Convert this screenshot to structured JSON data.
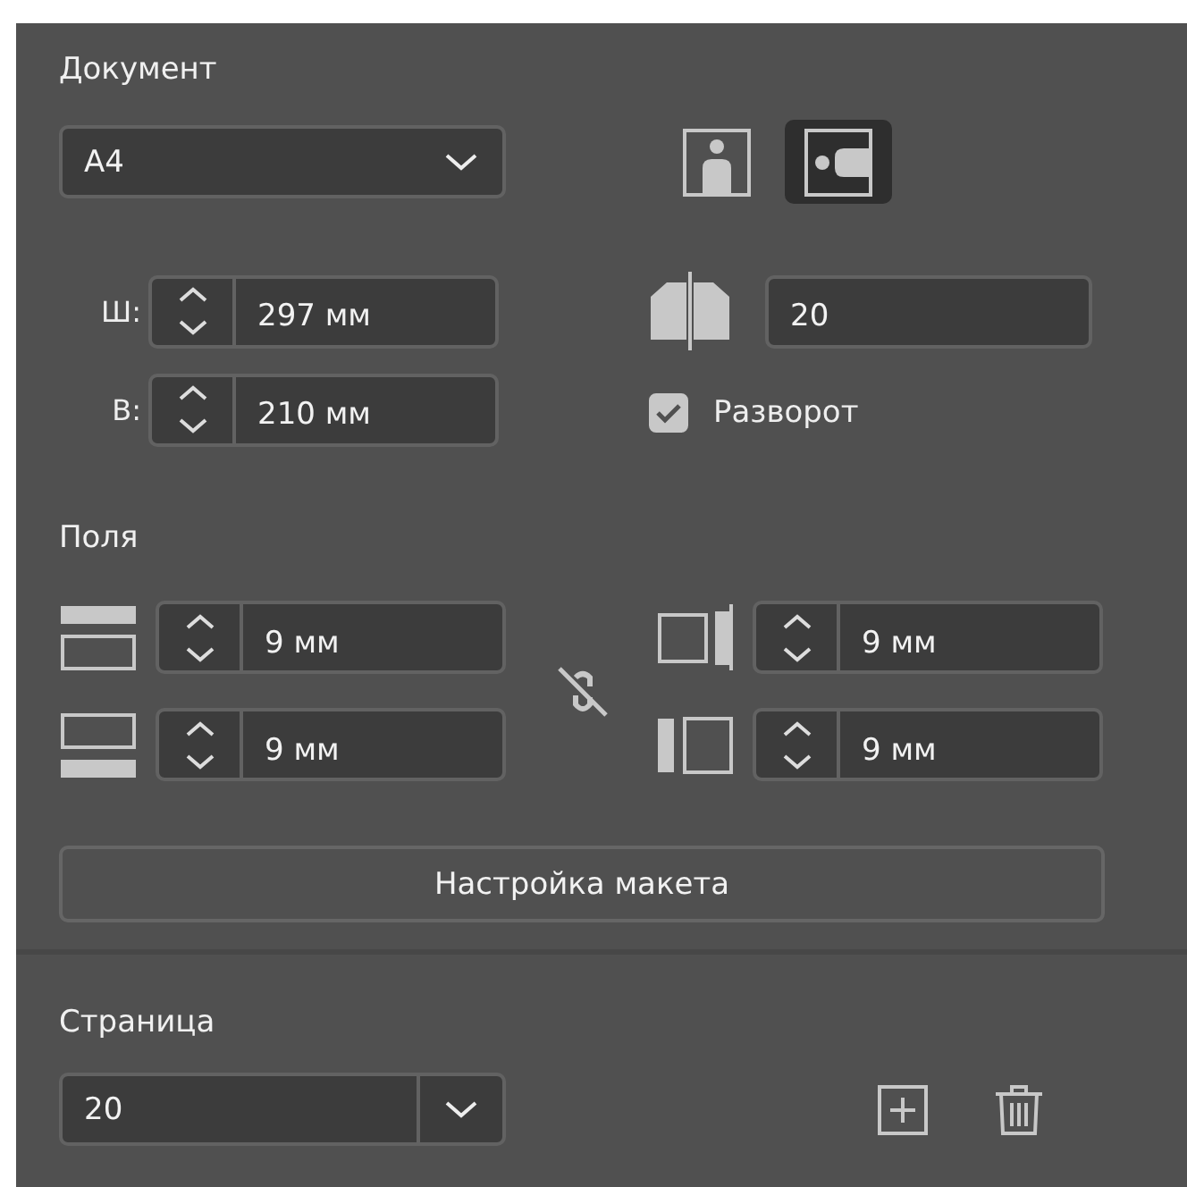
{
  "document": {
    "title": "Документ",
    "size": {
      "value": "A4"
    },
    "orientations": [
      {
        "kind": "portrait",
        "selected": false
      },
      {
        "kind": "landscape",
        "selected": true
      }
    ],
    "width": {
      "label": "Ш:",
      "value": "297 мм"
    },
    "height": {
      "label": "В:",
      "value": "210 мм"
    },
    "pages": {
      "value": "20"
    },
    "spread": {
      "label": "Разворот",
      "checked": true
    }
  },
  "margins": {
    "title": "Поля",
    "fields": [
      {
        "kind": "top",
        "value": "9 мм"
      },
      {
        "kind": "bottom",
        "value": "9 мм"
      },
      {
        "kind": "inner",
        "value": "9 мм"
      },
      {
        "kind": "outer",
        "value": "9 мм"
      }
    ],
    "button": "Настройка макета"
  },
  "page": {
    "title": "Страница",
    "value": "20"
  }
}
